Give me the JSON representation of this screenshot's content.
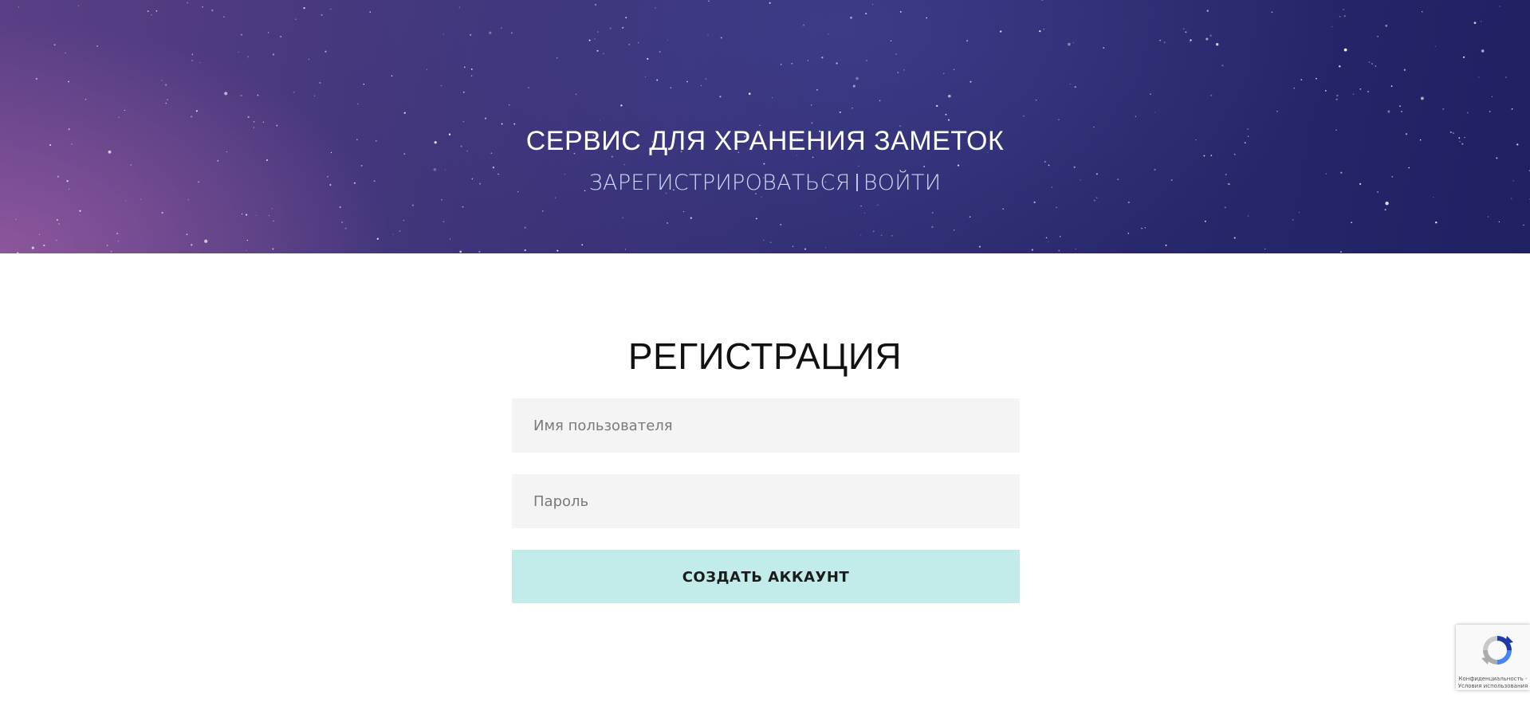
{
  "header": {
    "title": "СЕРВИС ДЛЯ ХРАНЕНИЯ ЗАМЕТОК",
    "nav": {
      "register_label": "ЗАРЕГИСТРИРОВАТЬСЯ",
      "login_label": "ВОЙТИ"
    }
  },
  "form": {
    "title": "РЕГИСТРАЦИЯ",
    "username_placeholder": "Имя пользователя",
    "password_placeholder": "Пароль",
    "submit_label": "СОЗДАТЬ АККАУНТ"
  },
  "recaptcha": {
    "terms_text": "Конфиденциальность - Условия использования",
    "icon": "recaptcha-logo-icon"
  },
  "colors": {
    "submit_background": "#c2ece9",
    "field_background": "#f4f4f4",
    "nav_link": "#c9d8f5",
    "hero_gradient_start": "#5a3f86",
    "hero_gradient_end": "#1f2163"
  }
}
